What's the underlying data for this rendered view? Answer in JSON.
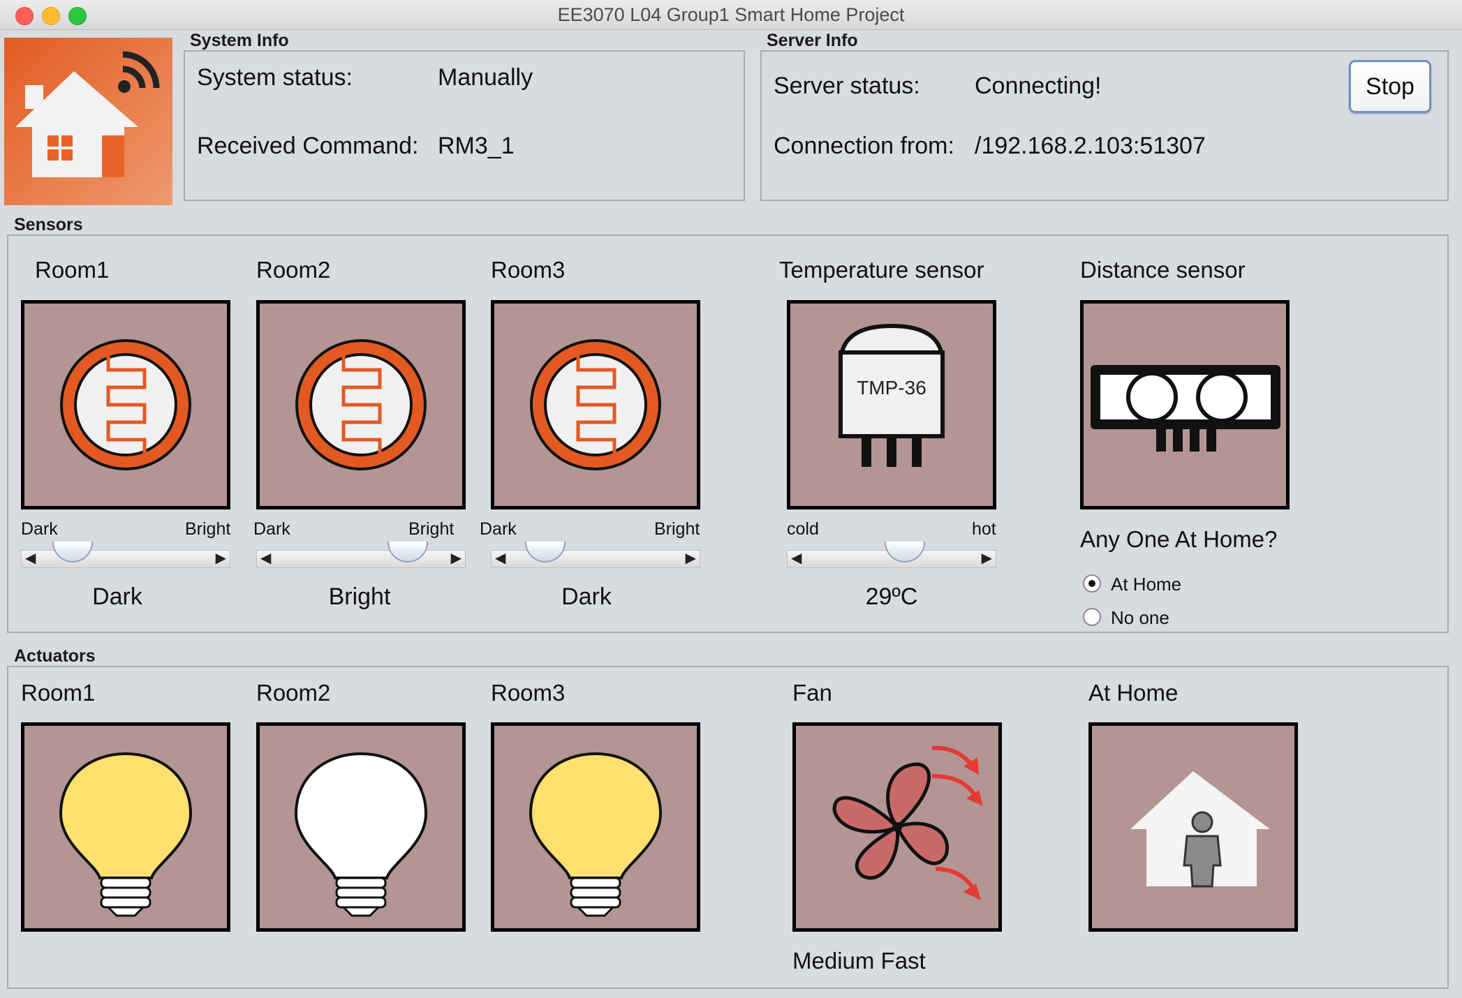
{
  "window": {
    "title": "EE3070 L04 Group1 Smart Home Project"
  },
  "app_icon": "smart-home-wifi-icon",
  "system_info": {
    "header": "System Info",
    "status_label": "System status:",
    "status_value": "Manually",
    "command_label": "Received Command:",
    "command_value": "RM3_1"
  },
  "server_info": {
    "header": "Server Info",
    "status_label": "Server status:",
    "status_value": "Connecting!",
    "connection_label": "Connection from:",
    "connection_value": "/192.168.2.103:51307",
    "stop_label": "Stop"
  },
  "sensors": {
    "header": "Sensors",
    "rooms": [
      {
        "title": "Room1",
        "icon": "photoresistor-icon",
        "min_label": "Dark",
        "max_label": "Bright",
        "level": 0.1,
        "state": "Dark"
      },
      {
        "title": "Room2",
        "icon": "photoresistor-icon",
        "min_label": "Dark",
        "max_label": "Bright",
        "level": 0.85,
        "state": "Bright"
      },
      {
        "title": "Room3",
        "icon": "photoresistor-icon",
        "min_label": "Dark",
        "max_label": "Bright",
        "level": 0.12,
        "state": "Dark"
      }
    ],
    "temperature": {
      "title": "Temperature sensor",
      "chip_label": "TMP-36",
      "min_label": "cold",
      "max_label": "hot",
      "level": 0.6,
      "value": "29ºC"
    },
    "distance": {
      "title": "Distance sensor",
      "question": "Any One At Home?",
      "options": [
        "At Home",
        "No one"
      ],
      "selected": "At Home"
    }
  },
  "actuators": {
    "header": "Actuators",
    "lights": [
      {
        "title": "Room1",
        "state": "on",
        "color": "#fde06d"
      },
      {
        "title": "Room2",
        "state": "off",
        "color": "#ffffff"
      },
      {
        "title": "Room3",
        "state": "on",
        "color": "#fde06d"
      }
    ],
    "fan": {
      "title": "Fan",
      "speed": "Medium Fast",
      "blade_color": "#c96a6a",
      "arrow_color": "#e53935"
    },
    "home": {
      "title": "At Home",
      "icon": "person-at-home-icon"
    }
  },
  "colors": {
    "tile_bg": "#b39594",
    "accent_orange": "#e8642a",
    "window_bg": "#d8dbe0"
  }
}
